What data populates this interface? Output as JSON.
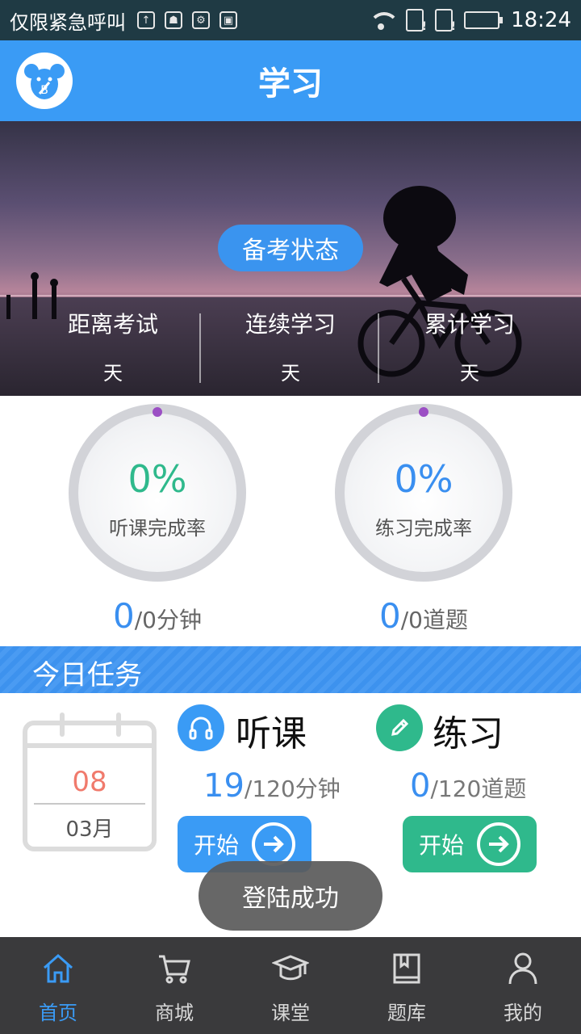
{
  "status_bar": {
    "carrier": "仅限紧急呼叫",
    "time": "18:24"
  },
  "header": {
    "title": "学习"
  },
  "banner": {
    "status_button": "备考状态",
    "stats": [
      {
        "label": "距离考试",
        "unit": "天"
      },
      {
        "label": "连续学习",
        "unit": "天"
      },
      {
        "label": "累计学习",
        "unit": "天"
      }
    ]
  },
  "progress": {
    "listen": {
      "percent": "0%",
      "label": "听课完成率",
      "value": "0",
      "suffix": "/0分钟"
    },
    "practice": {
      "percent": "0%",
      "label": "练习完成率",
      "value": "0",
      "suffix": "/0道题"
    }
  },
  "tasks": {
    "section_title": "今日任务",
    "calendar": {
      "day": "08",
      "month": "03月"
    },
    "listen": {
      "title": "听课",
      "done": "19",
      "total": "/120分钟",
      "button": "开始"
    },
    "practice": {
      "title": "练习",
      "done": "0",
      "total": "/120道题",
      "button": "开始"
    }
  },
  "toast": "登陆成功",
  "bottom_nav": [
    {
      "label": "首页",
      "icon": "home-icon",
      "active": true
    },
    {
      "label": "商城",
      "icon": "cart-icon",
      "active": false
    },
    {
      "label": "课堂",
      "icon": "graduation-cap-icon",
      "active": false
    },
    {
      "label": "题库",
      "icon": "book-icon",
      "active": false
    },
    {
      "label": "我的",
      "icon": "user-icon",
      "active": false
    }
  ],
  "colors": {
    "brand_blue": "#3a9bf5",
    "green": "#2fb98c",
    "calendar_red": "#f07a6c"
  }
}
